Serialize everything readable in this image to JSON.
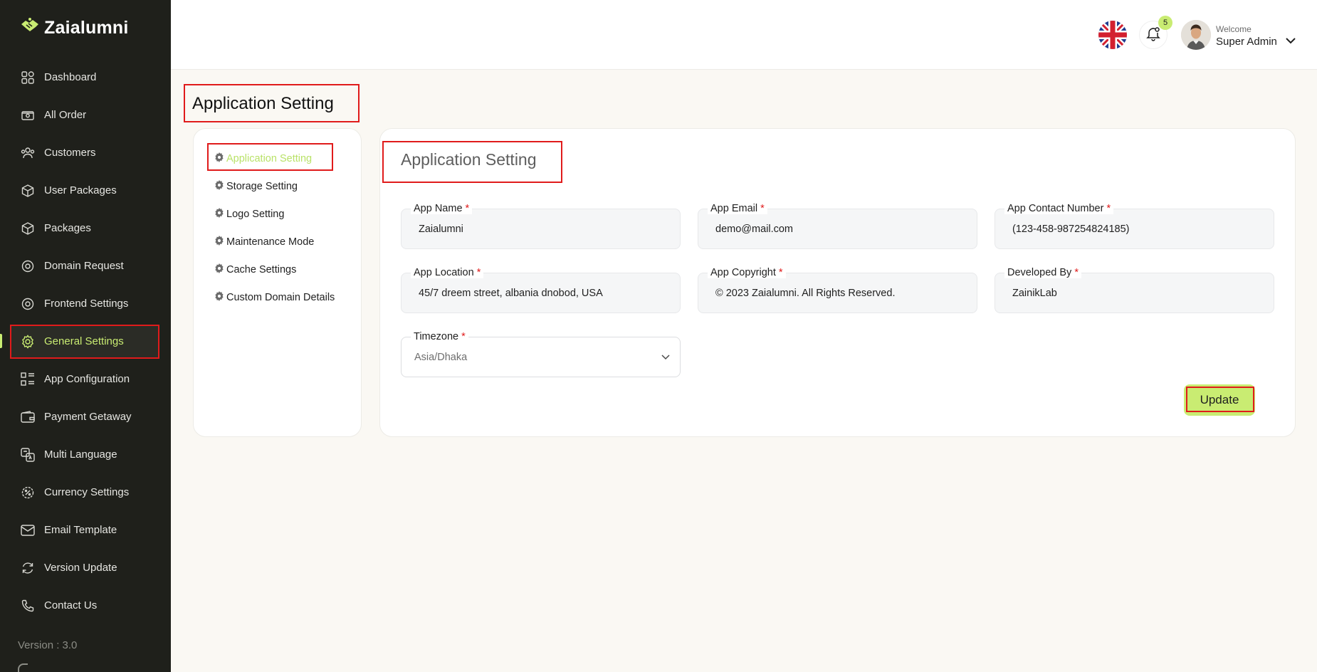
{
  "brand": {
    "name": "Zaialumni",
    "accent": "#c9ec72"
  },
  "sidebar": {
    "items": [
      {
        "label": "Dashboard",
        "icon": "dashboard-icon"
      },
      {
        "label": "All Order",
        "icon": "order-icon"
      },
      {
        "label": "Customers",
        "icon": "customers-icon"
      },
      {
        "label": "User Packages",
        "icon": "package-icon"
      },
      {
        "label": "Packages",
        "icon": "package-icon"
      },
      {
        "label": "Domain Request",
        "icon": "domain-icon"
      },
      {
        "label": "Frontend Settings",
        "icon": "frontend-icon"
      },
      {
        "label": "General Settings",
        "icon": "gear-icon",
        "active": true
      },
      {
        "label": "App Configuration",
        "icon": "app-config-icon"
      },
      {
        "label": "Payment Getaway",
        "icon": "wallet-icon"
      },
      {
        "label": "Multi Language",
        "icon": "language-icon"
      },
      {
        "label": "Currency Settings",
        "icon": "currency-icon"
      },
      {
        "label": "Email Template",
        "icon": "email-icon"
      },
      {
        "label": "Version Update",
        "icon": "refresh-icon"
      },
      {
        "label": "Contact Us",
        "icon": "phone-icon"
      }
    ],
    "version": "Version : 3.0"
  },
  "header": {
    "notification_count": "5",
    "welcome": "Welcome",
    "user_name": "Super Admin"
  },
  "page": {
    "title": "Application Setting"
  },
  "settings_menu": {
    "items": [
      {
        "label": "Application Setting",
        "active": true
      },
      {
        "label": "Storage Setting"
      },
      {
        "label": "Logo Setting"
      },
      {
        "label": "Maintenance Mode"
      },
      {
        "label": "Cache Settings"
      },
      {
        "label": "Custom Domain Details"
      }
    ]
  },
  "form": {
    "title": "Application Setting",
    "required_mark": "*",
    "fields": {
      "app_name": {
        "label": "App Name",
        "value": "Zaialumni"
      },
      "app_email": {
        "label": "App Email",
        "value": "demo@mail.com"
      },
      "app_contact": {
        "label": "App Contact Number",
        "value": "(123-458-987254824185)"
      },
      "app_location": {
        "label": "App Location",
        "value": "45/7 dreem street, albania dnobod, USA"
      },
      "app_copyright": {
        "label": "App Copyright",
        "value": "© 2023 Zaialumni. All Rights Reserved."
      },
      "developed_by": {
        "label": "Developed By",
        "value": "ZainikLab"
      },
      "timezone": {
        "label": "Timezone",
        "value": "Asia/Dhaka"
      }
    },
    "update_label": "Update"
  }
}
